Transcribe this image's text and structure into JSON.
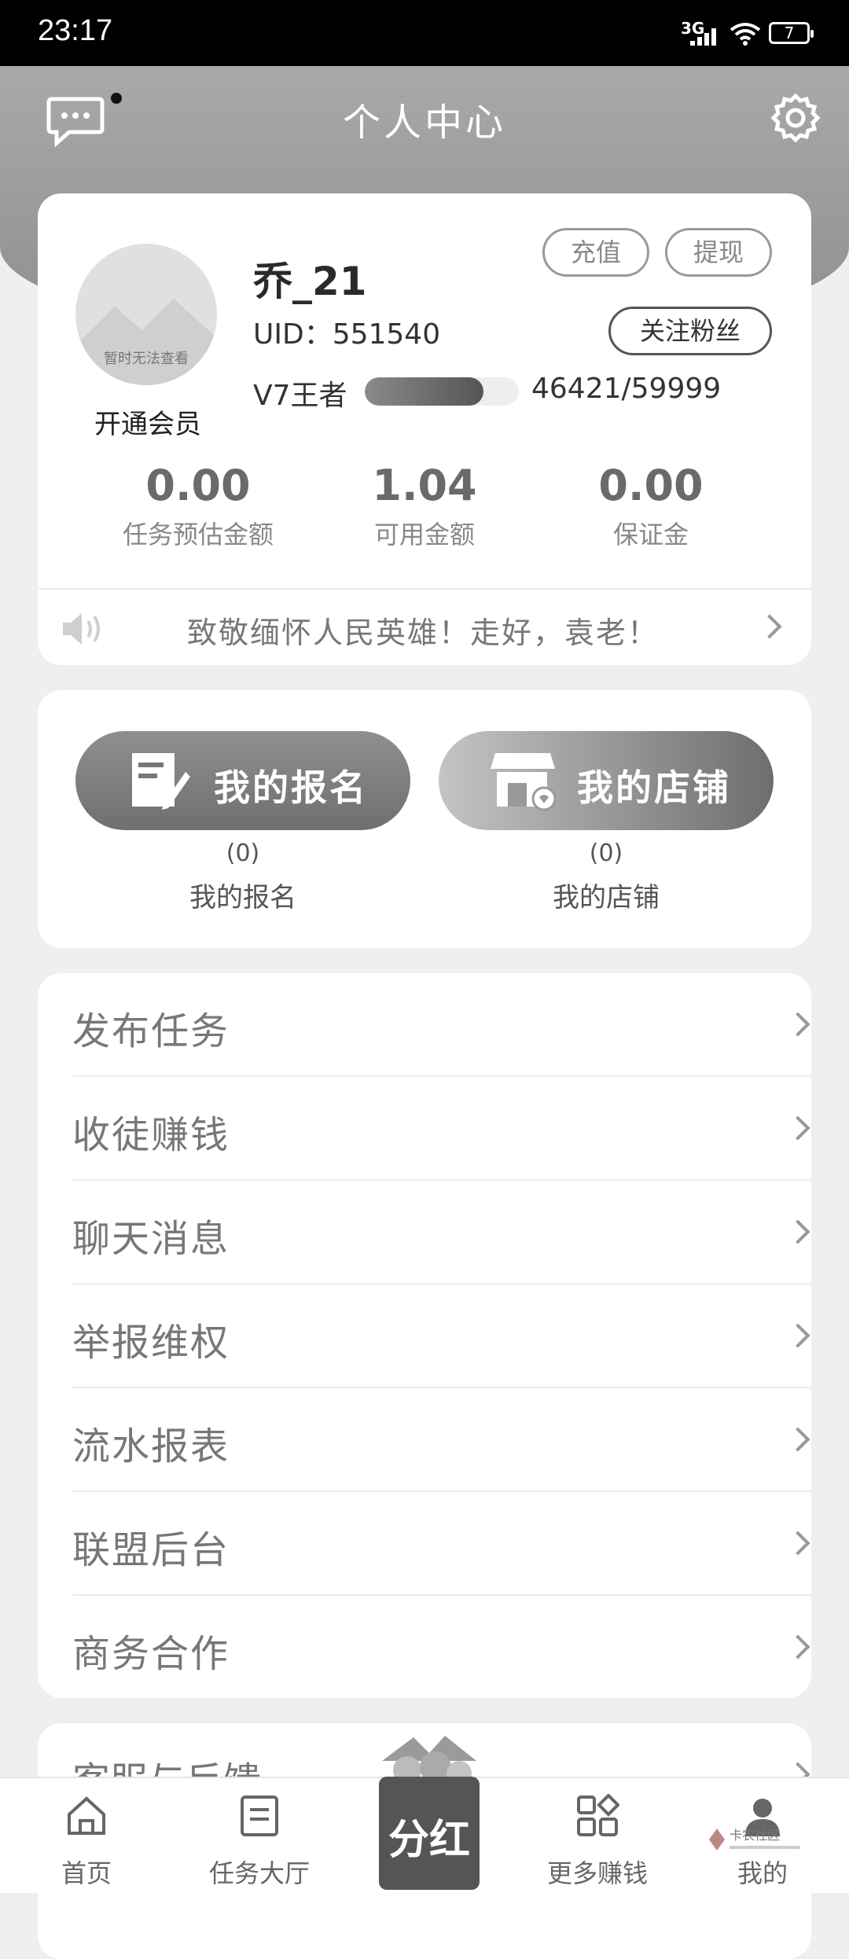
{
  "status_bar": {
    "time": "23:17",
    "network": "3G",
    "battery": "7"
  },
  "header": {
    "title": "个人中心"
  },
  "profile": {
    "avatar_caption": "暂时无法查看",
    "open_vip": "开通会员",
    "username": "乔_21",
    "uid": "UID：551540",
    "level": "V7王者",
    "level_progress": 0.77,
    "level_numbers": "46421/59999",
    "buttons": {
      "recharge": "充值",
      "withdraw": "提现",
      "follow_fans": "关注粉丝"
    },
    "stats": [
      {
        "value": "0.00",
        "label": "任务预估金额"
      },
      {
        "value": "1.04",
        "label": "可用金额"
      },
      {
        "value": "0.00",
        "label": "保证金"
      }
    ],
    "notice": "致敬缅怀人民英雄！走好，袁老！"
  },
  "actions": {
    "signup": {
      "button": "我的报名",
      "count": "(0)",
      "label": "我的报名"
    },
    "shop": {
      "button": "我的店铺",
      "count": "(0)",
      "label": "我的店铺"
    }
  },
  "menu": [
    "发布任务",
    "收徒赚钱",
    "聊天消息",
    "举报维权",
    "流水报表",
    "联盟后台",
    "商务合作"
  ],
  "menu2": [
    "客服与反馈"
  ],
  "tabbar": {
    "home": "首页",
    "tasks": "任务大厅",
    "center": "分红",
    "more": "更多赚钱",
    "mine": "我的"
  },
  "watermark": "卡农社区"
}
